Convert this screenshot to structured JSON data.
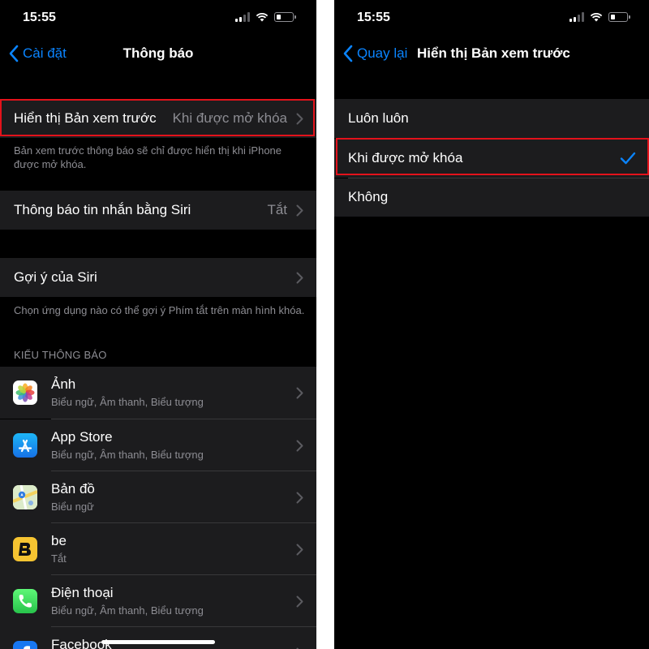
{
  "colors": {
    "accent": "#0a84ff",
    "highlight": "#e3121b",
    "cell": "#1c1c1e",
    "secondary_text": "#8d8d93"
  },
  "left": {
    "status": {
      "time": "15:55"
    },
    "nav": {
      "back_label": "Cài đặt",
      "title": "Thông báo"
    },
    "show_previews": {
      "label": "Hiển thị Bản xem trước",
      "value": "Khi được mở khóa"
    },
    "show_previews_note": "Bản xem trước thông báo sẽ chỉ được hiển thị khi iPhone được mở khóa.",
    "siri_announce": {
      "label": "Thông báo tin nhắn bằng Siri",
      "value": "Tắt"
    },
    "siri_suggestions": {
      "label": "Gợi ý của Siri"
    },
    "siri_note": "Chọn ứng dụng nào có thể gợi ý Phím tắt trên màn hình khóa.",
    "section_header": "KIỂU THÔNG BÁO",
    "apps": [
      {
        "name": "Ảnh",
        "subtitle": "Biểu ngữ, Âm thanh, Biểu tượng",
        "icon": "photos-icon"
      },
      {
        "name": "App Store",
        "subtitle": "Biểu ngữ, Âm thanh, Biểu tượng",
        "icon": "app-store-icon"
      },
      {
        "name": "Bản đồ",
        "subtitle": "Biểu ngữ",
        "icon": "maps-icon"
      },
      {
        "name": "be",
        "subtitle": "Tắt",
        "icon": "be-icon"
      },
      {
        "name": "Điện thoại",
        "subtitle": "Biểu ngữ, Âm thanh, Biểu tượng",
        "icon": "phone-icon"
      },
      {
        "name": "Facebook",
        "subtitle": "",
        "icon": "facebook-icon"
      }
    ]
  },
  "right": {
    "status": {
      "time": "15:55"
    },
    "nav": {
      "back_label": "Quay lại",
      "title": "Hiển thị Bản xem trước"
    },
    "options": [
      {
        "label": "Luôn luôn",
        "selected": false
      },
      {
        "label": "Khi được mở khóa",
        "selected": true
      },
      {
        "label": "Không",
        "selected": false
      }
    ]
  }
}
